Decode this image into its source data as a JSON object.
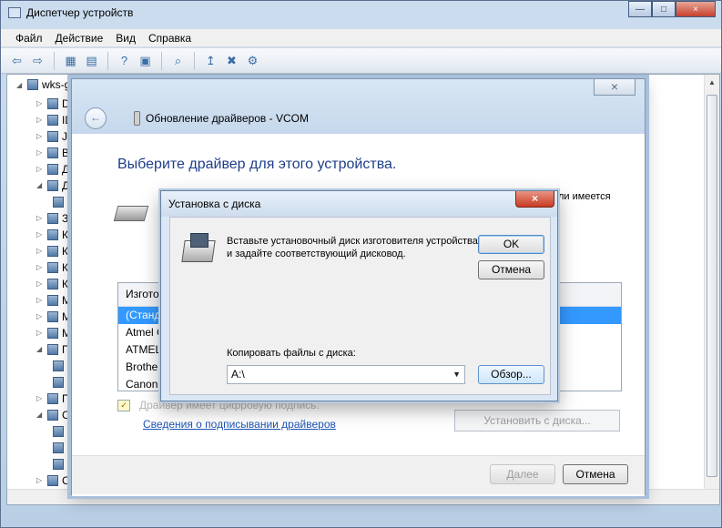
{
  "main_window": {
    "title": "Диспетчер устройств",
    "menu": [
      "Файл",
      "Действие",
      "Вид",
      "Справка"
    ],
    "tree": {
      "root": "wks-g",
      "items": [
        "DV",
        "ID",
        "Ju",
        "Ви",
        "Ди",
        "Д",
        "",
        "Зв",
        "Кл",
        "Ко",
        "Ко",
        "Ко",
        "Ме",
        "Мо",
        "Мо",
        "По",
        "",
        "",
        "Пр",
        "Се",
        "",
        "",
        "",
        "Си",
        "Ус"
      ]
    }
  },
  "update_window": {
    "title": "Обновление драйверов - VCOM",
    "heading": "Выберите драйвер для этого устройства.",
    "partial_text": "ли имеется",
    "list": {
      "header": "Изгото",
      "rows": [
        "(Станда",
        "Atmel C",
        "ATMEL,",
        "Brother",
        "Canon..."
      ]
    },
    "signed_text": "Драйвер имеет цифровую подпись.",
    "signature_link": "Сведения о подписывании драйверов",
    "install_disk_button": "Установить с диска...",
    "next_button": "Далее",
    "cancel_button": "Отмена"
  },
  "disk_dialog": {
    "title": "Установка с диска",
    "instructions": "Вставьте установочный диск изготовителя устройства и задайте соответствующий дисковод.",
    "ok_button": "OK",
    "cancel_button": "Отмена",
    "copy_label": "Копировать файлы с диска:",
    "path_value": "A:\\",
    "browse_button": "Обзор..."
  }
}
